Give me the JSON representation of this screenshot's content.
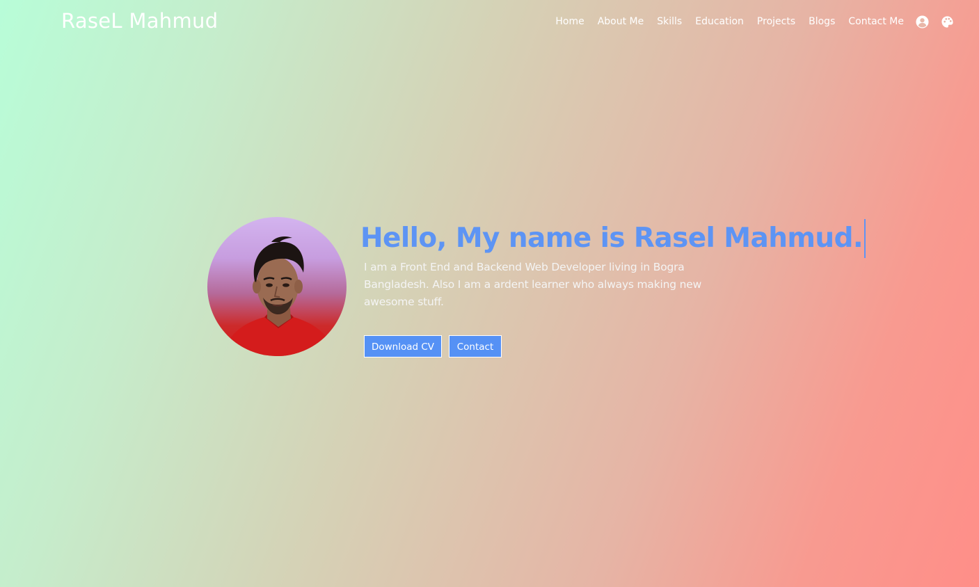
{
  "nav": {
    "brand": "RaseL Mahmud",
    "links": [
      "Home",
      "About Me",
      "Skills",
      "Education",
      "Projects",
      "Blogs",
      "Contact Me"
    ],
    "icons": [
      "user-circle-icon",
      "palette-icon"
    ]
  },
  "hero": {
    "headline": "Hello, My name is Rasel Mahmud.",
    "intro": "I am a Front End and Backend Web Developer living in Bogra Bangladesh. Also I am a ardent learner who always making new awesome stuff.",
    "download_label": "Download CV",
    "contact_label": "Contact"
  },
  "colors": {
    "accent": "#5591f5",
    "headline": "#5d94f4",
    "gradient_start": "#b8fdd8",
    "gradient_end": "#ff8e88"
  }
}
